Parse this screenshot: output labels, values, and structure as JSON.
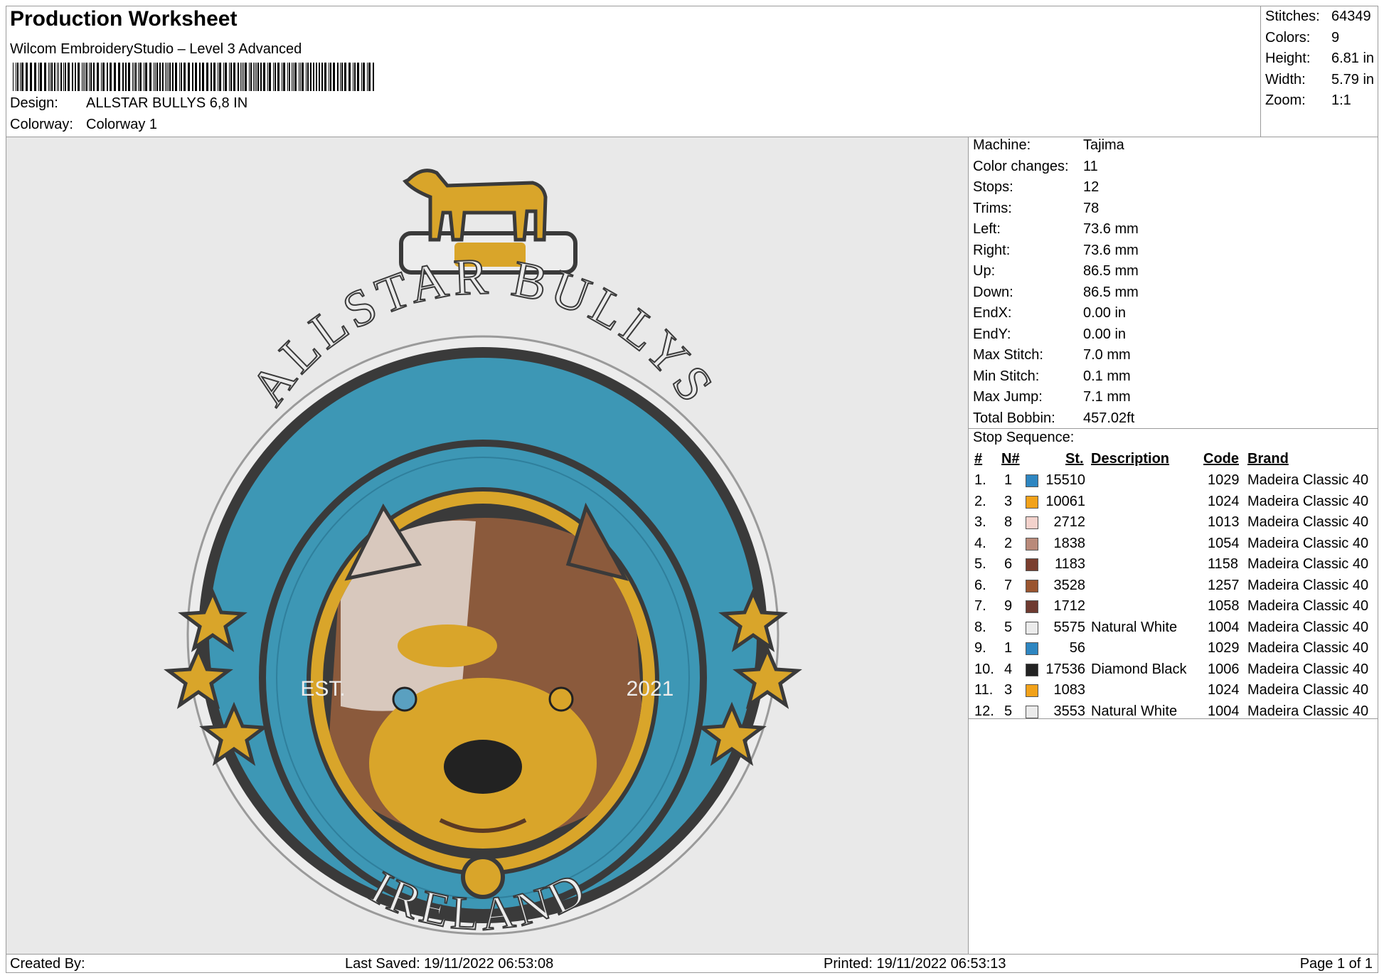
{
  "header": {
    "title": "Production Worksheet",
    "software": "Wilcom EmbroideryStudio – Level 3 Advanced",
    "design_label": "Design:",
    "design_value": "ALLSTAR BULLYS 6,8 IN",
    "colorway_label": "Colorway:",
    "colorway_value": "Colorway 1"
  },
  "stats": [
    {
      "label": "Stitches:",
      "value": "64349"
    },
    {
      "label": "Colors:",
      "value": "9"
    },
    {
      "label": "Height:",
      "value": "6.81 in"
    },
    {
      "label": "Width:",
      "value": "5.79 in"
    },
    {
      "label": "Zoom:",
      "value": "1:1"
    }
  ],
  "machine_info": [
    {
      "label": "Machine:",
      "value": "Tajima"
    },
    {
      "label": "Color changes:",
      "value": "11"
    },
    {
      "label": "Stops:",
      "value": "12"
    },
    {
      "label": "Trims:",
      "value": "78"
    },
    {
      "label": "Left:",
      "value": "73.6 mm"
    },
    {
      "label": "Right:",
      "value": "73.6 mm"
    },
    {
      "label": "Up:",
      "value": "86.5 mm"
    },
    {
      "label": "Down:",
      "value": "86.5 mm"
    },
    {
      "label": "EndX:",
      "value": "0.00 in"
    },
    {
      "label": "EndY:",
      "value": "0.00 in"
    },
    {
      "label": "Max Stitch:",
      "value": "7.0 mm"
    },
    {
      "label": "Min Stitch:",
      "value": "0.1 mm"
    },
    {
      "label": "Max Jump:",
      "value": "7.1 mm"
    },
    {
      "label": "Total Bobbin:",
      "value": "457.02ft"
    }
  ],
  "stop_sequence": {
    "title": "Stop Sequence:",
    "headers": {
      "num": "#",
      "needle": "N#",
      "stitches": "St.",
      "description": "Description",
      "code": "Code",
      "brand": "Brand"
    },
    "rows": [
      {
        "num": "1.",
        "needle": "1",
        "color": "#2e86c1",
        "stitches": "15510",
        "description": "",
        "code": "1029",
        "brand": "Madeira Classic 40"
      },
      {
        "num": "2.",
        "needle": "3",
        "color": "#f2a21a",
        "stitches": "10061",
        "description": "",
        "code": "1024",
        "brand": "Madeira Classic 40"
      },
      {
        "num": "3.",
        "needle": "8",
        "color": "#f3d2cc",
        "stitches": "2712",
        "description": "",
        "code": "1013",
        "brand": "Madeira Classic 40"
      },
      {
        "num": "4.",
        "needle": "2",
        "color": "#b98a7a",
        "stitches": "1838",
        "description": "",
        "code": "1054",
        "brand": "Madeira Classic 40"
      },
      {
        "num": "5.",
        "needle": "6",
        "color": "#7a3e2e",
        "stitches": "1183",
        "description": "",
        "code": "1158",
        "brand": "Madeira Classic 40"
      },
      {
        "num": "6.",
        "needle": "7",
        "color": "#9a5530",
        "stitches": "3528",
        "description": "",
        "code": "1257",
        "brand": "Madeira Classic 40"
      },
      {
        "num": "7.",
        "needle": "9",
        "color": "#6e3a30",
        "stitches": "1712",
        "description": "",
        "code": "1058",
        "brand": "Madeira Classic 40"
      },
      {
        "num": "8.",
        "needle": "5",
        "color": "#ebebeb",
        "stitches": "5575",
        "description": "Natural White",
        "code": "1004",
        "brand": "Madeira Classic 40"
      },
      {
        "num": "9.",
        "needle": "1",
        "color": "#2e86c1",
        "stitches": "56",
        "description": "",
        "code": "1029",
        "brand": "Madeira Classic 40"
      },
      {
        "num": "10.",
        "needle": "4",
        "color": "#222222",
        "stitches": "17536",
        "description": "Diamond Black",
        "code": "1006",
        "brand": "Madeira Classic 40"
      },
      {
        "num": "11.",
        "needle": "3",
        "color": "#f2a21a",
        "stitches": "1083",
        "description": "",
        "code": "1024",
        "brand": "Madeira Classic 40"
      },
      {
        "num": "12.",
        "needle": "5",
        "color": "#ebebeb",
        "stitches": "3553",
        "description": "Natural White",
        "code": "1004",
        "brand": "Madeira Classic 40"
      }
    ]
  },
  "design_preview": {
    "top_text": "ALLSTAR BULLYS",
    "bottom_text": "IRELAND",
    "est_left": "EST.",
    "est_right": "2021",
    "colors": {
      "blue": "#3d97b5",
      "gold": "#d9a52a",
      "dark": "#3a3a3a",
      "white": "#ececec",
      "brown": "#8b5a3c",
      "cream": "#d8c8bd"
    }
  },
  "footer": {
    "created_by": "Created By:",
    "last_saved": "Last Saved: 19/11/2022 06:53:08",
    "printed": "Printed: 19/11/2022 06:53:13",
    "page": "Page 1 of 1"
  }
}
